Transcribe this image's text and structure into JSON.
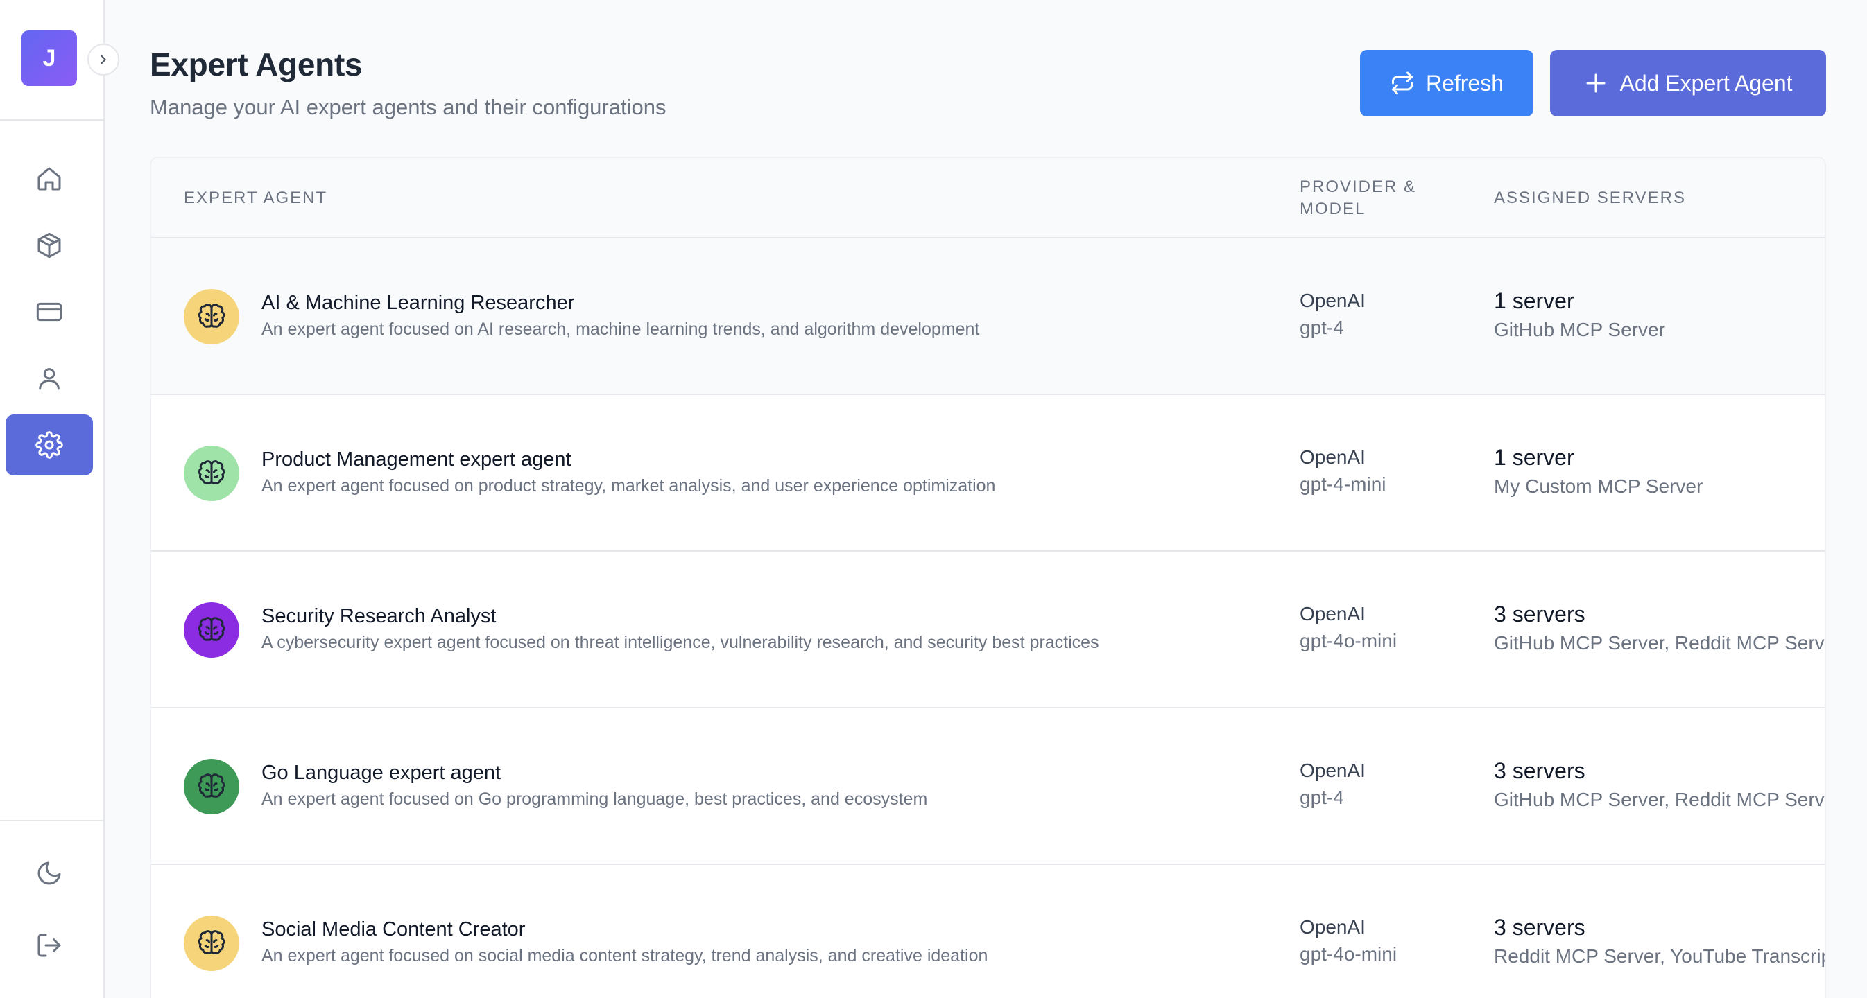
{
  "user": {
    "initial": "J"
  },
  "sidebar": {
    "items": [
      {
        "icon": "home-icon",
        "active": false
      },
      {
        "icon": "package-icon",
        "active": false
      },
      {
        "icon": "credit-card-icon",
        "active": false
      },
      {
        "icon": "user-icon",
        "active": false
      },
      {
        "icon": "gear-icon",
        "active": true
      }
    ],
    "bottom": [
      {
        "icon": "moon-icon"
      },
      {
        "icon": "logout-icon"
      }
    ]
  },
  "header": {
    "title": "Expert Agents",
    "subtitle": "Manage your AI expert agents and their configurations",
    "refresh_label": "Refresh",
    "add_label": "Add Expert Agent"
  },
  "table": {
    "columns": {
      "agent": "Expert Agent",
      "provider": "Provider & Model",
      "servers": "Assigned Servers"
    },
    "rows": [
      {
        "name": "AI & Machine Learning Researcher",
        "description": "An expert agent focused on AI research, machine learning trends, and algorithm development",
        "provider": "OpenAI",
        "model": "gpt-4",
        "server_count": "1 server",
        "servers": "GitHub MCP Server",
        "icon_color": "#f6d57a"
      },
      {
        "name": "Product Management expert agent",
        "description": "An expert agent focused on product strategy, market analysis, and user experience optimization",
        "provider": "OpenAI",
        "model": "gpt-4-mini",
        "server_count": "1 server",
        "servers": "My Custom MCP Server",
        "icon_color": "#9fe3a8"
      },
      {
        "name": "Security Research Analyst",
        "description": "A cybersecurity expert agent focused on threat intelligence, vulnerability research, and security best practices",
        "provider": "OpenAI",
        "model": "gpt-4o-mini",
        "server_count": "3 servers",
        "servers": "GitHub MCP Server, Reddit MCP Server, SQLite M",
        "icon_color": "#8b2be2"
      },
      {
        "name": "Go Language expert agent",
        "description": "An expert agent focused on Go programming language, best practices, and ecosystem",
        "provider": "OpenAI",
        "model": "gpt-4",
        "server_count": "3 servers",
        "servers": "GitHub MCP Server, Reddit MCP Server, SQLite M",
        "icon_color": "#3e9b57"
      },
      {
        "name": "Social Media Content Creator",
        "description": "An expert agent focused on social media content strategy, trend analysis, and creative ideation",
        "provider": "OpenAI",
        "model": "gpt-4o-mini",
        "server_count": "3 servers",
        "servers": "Reddit MCP Server, YouTube Transcript MCP Serv",
        "icon_color": "#f6d57a"
      }
    ]
  },
  "colors": {
    "accent": "#5b6bd9",
    "refresh": "#3b82f6"
  }
}
